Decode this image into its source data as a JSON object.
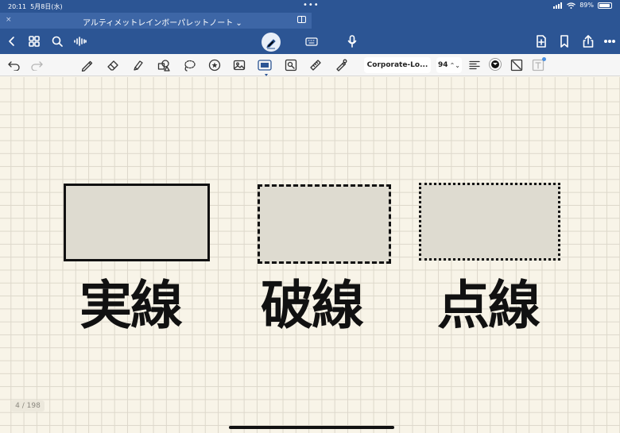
{
  "status_bar": {
    "time": "20:11",
    "date": "5月8日(水)",
    "dots": "•••",
    "battery": "89%"
  },
  "tab": {
    "close": "×",
    "title": "アルティメットレインボーパレットノート ⌄"
  },
  "nav": {
    "icons": [
      "back-icon",
      "grid-icon",
      "search-icon",
      "voice-wave-icon",
      "pen-mode-icon",
      "keyboard-icon",
      "microphone-icon",
      "add-page-icon",
      "bookmark-icon",
      "share-icon",
      "more-icon"
    ]
  },
  "toolbar": {
    "tools": [
      "undo-icon",
      "redo-icon",
      "pen-icon",
      "eraser-icon",
      "highlighter-icon",
      "shapes-icon",
      "lasso-icon",
      "sticker-icon",
      "image-icon",
      "text-box-icon",
      "scan-icon",
      "ruler-icon",
      "laser-icon"
    ],
    "font_name": "Corporate-Lo...",
    "font_size": "94",
    "stepper": "⌃⌄",
    "text_color": "#111111"
  },
  "canvas": {
    "labels": {
      "solid": "実線",
      "dashed": "破線",
      "dotted": "点線"
    },
    "fill_color": "#dedbd0",
    "stroke_color": "#111111"
  },
  "page_indicator": "4 / 198",
  "colors": {
    "header_blue": "#2c5594",
    "paper": "#f8f4e8",
    "grid": "#ddd8cb"
  }
}
